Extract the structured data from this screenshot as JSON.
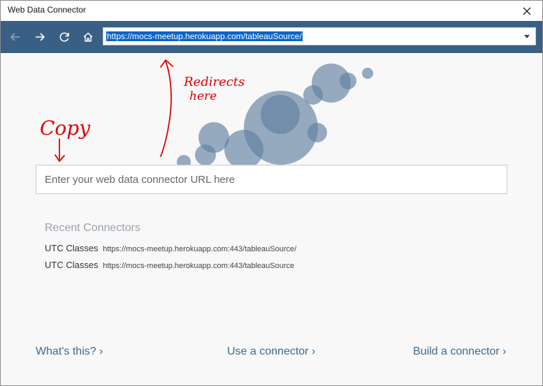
{
  "window": {
    "title": "Web Data Connector",
    "close_glyph": "✕"
  },
  "nav": {
    "back_icon": "arrow-left",
    "forward_icon": "arrow-right",
    "refresh_icon": "refresh",
    "home_icon": "home",
    "address": "https://mocs-meetup.herokuapp.com/tableauSource/"
  },
  "connector_input": {
    "placeholder": "Enter your web data connector URL here",
    "value": ""
  },
  "recent": {
    "title": "Recent Connectors",
    "items": [
      {
        "name": "UTC Classes",
        "url": "https://mocs-meetup.herokuapp.com:443/tableauSource/"
      },
      {
        "name": "UTC Classes",
        "url": "https://mocs-meetup.herokuapp.com:443/tableauSource"
      }
    ]
  },
  "footer": {
    "whats_this": "What's this? ›",
    "use_connector": "Use a connector ›",
    "build_connector": "Build a connector ›"
  },
  "annotations": {
    "copy_text": "Copy",
    "redirect_text_line1": "Redirects",
    "redirect_text_line2": "here",
    "ink_color": "#e00000"
  },
  "colors": {
    "nav_bar": "#3a5f84",
    "bubble": "#5f7fa0",
    "link": "#3a6b8e",
    "selection": "#0a64c8"
  }
}
